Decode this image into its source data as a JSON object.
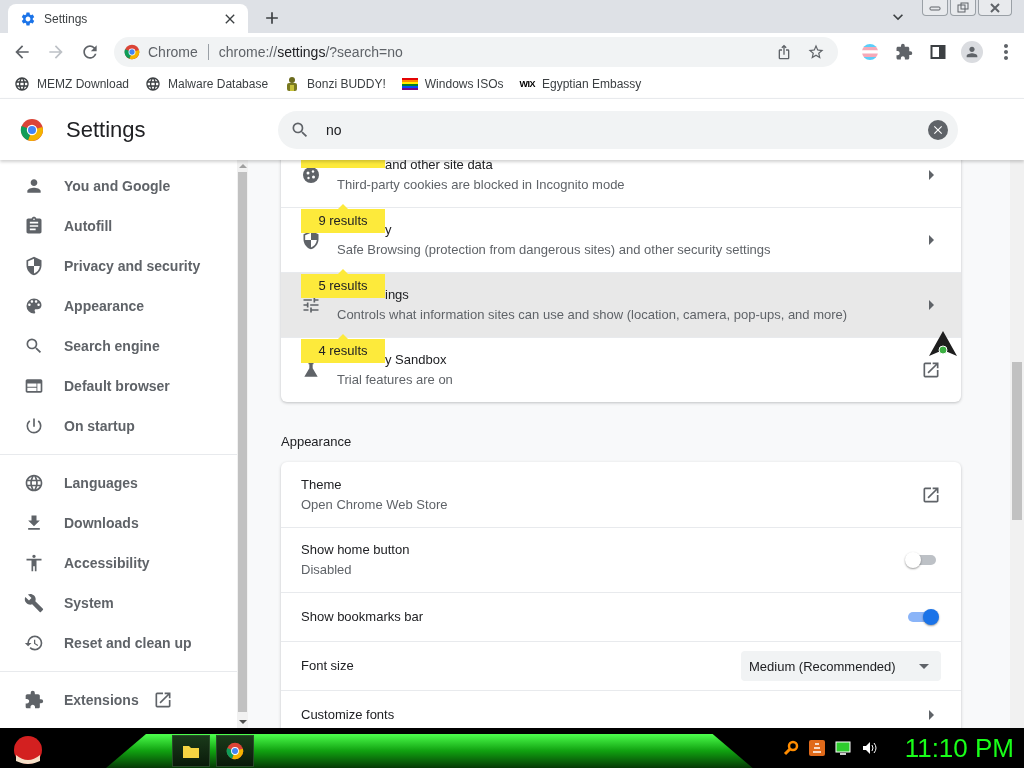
{
  "browser": {
    "tabs": [
      {
        "title": "Settings",
        "selected": true
      }
    ],
    "nav": {
      "back_disabled": false,
      "forward_disabled": true
    },
    "omnibox": {
      "site_label": "Chrome",
      "url_scheme": "chrome://",
      "url_host": "settings",
      "url_rest": "/?search=no"
    },
    "bookmarks": [
      {
        "label": "MEMZ Download"
      },
      {
        "label": "Malware Database"
      },
      {
        "label": "Bonzi BUDDY!"
      },
      {
        "label": "Windows ISOs"
      },
      {
        "label": "Egyptian Embassy",
        "favicon_text": "WIX"
      }
    ]
  },
  "settings": {
    "title": "Settings",
    "search": {
      "value": "no"
    },
    "sidebar": {
      "groups": [
        [
          {
            "label": "You and Google"
          },
          {
            "label": "Autofill"
          },
          {
            "label": "Privacy and security"
          },
          {
            "label": "Appearance"
          },
          {
            "label": "Search engine"
          },
          {
            "label": "Default browser"
          },
          {
            "label": "On startup"
          }
        ],
        [
          {
            "label": "Languages"
          },
          {
            "label": "Downloads"
          },
          {
            "label": "Accessibility"
          },
          {
            "label": "System"
          },
          {
            "label": "Reset and clean up"
          }
        ],
        [
          {
            "label": "Extensions",
            "external": true
          }
        ]
      ]
    },
    "sections": [
      {
        "rows": [
          {
            "kind": "arrow",
            "title": "and other site data",
            "subtitle": "Third-party cookies are blocked in Incognito mode",
            "badge_cut": true,
            "hovered": false
          },
          {
            "kind": "arrow",
            "title": "y",
            "subtitle": "Safe Browsing (protection from dangerous sites) and other security settings",
            "badge": "9 results",
            "badge_cut": false,
            "hovered": false
          },
          {
            "kind": "arrow",
            "title": "ings",
            "subtitle": "Controls what information sites can use and show (location, camera, pop-ups, and more)",
            "badge": "5 results",
            "badge_cut": false,
            "hovered": true
          },
          {
            "kind": "external",
            "title": "y Sandbox",
            "subtitle": "Trial features are on",
            "badge": "4 results",
            "badge_cut": false,
            "hovered": false
          }
        ]
      },
      {
        "heading": "Appearance",
        "rows": [
          {
            "kind": "external",
            "title": "Theme",
            "subtitle": "Open Chrome Web Store",
            "hovered": false
          },
          {
            "kind": "toggle",
            "title": "Show home button",
            "subtitle": "Disabled",
            "on": false,
            "hovered": false
          },
          {
            "kind": "toggle",
            "title": "Show bookmarks bar",
            "on": true,
            "hovered": false
          },
          {
            "kind": "dropdown",
            "title": "Font size",
            "value": "Medium (Recommended)",
            "hovered": false
          },
          {
            "kind": "arrow",
            "title": "Customize fonts",
            "hovered": false
          }
        ]
      }
    ]
  },
  "taskbar": {
    "clock": "11:10 PM"
  }
}
